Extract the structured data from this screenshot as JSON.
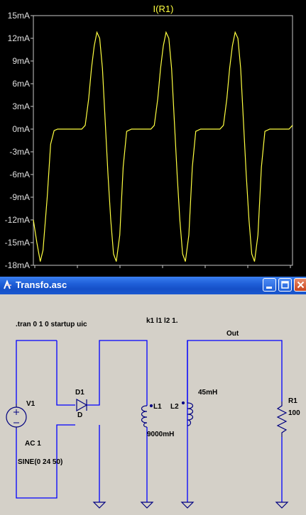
{
  "plot": {
    "title": "I(R1)",
    "y_ticks": [
      "15mA",
      "12mA",
      "9mA",
      "6mA",
      "3mA",
      "0mA",
      "-3mA",
      "-6mA",
      "-9mA",
      "-12mA",
      "-15mA",
      "-18mA"
    ],
    "trace_color": "#ffff40",
    "background": "#000000"
  },
  "chart_data": {
    "type": "line",
    "title": "I(R1)",
    "xlabel": "",
    "ylabel": "",
    "ylim": [
      -18,
      15
    ],
    "yunit": "mA",
    "grid": false,
    "series": [
      {
        "name": "I(R1)",
        "x": [
          0.0,
          0.05,
          0.1,
          0.14,
          0.2,
          0.25,
          0.3,
          0.35,
          0.42,
          0.5,
          0.58,
          0.65,
          0.7,
          0.75,
          0.8,
          0.84,
          0.88,
          0.92,
          0.96,
          1.0,
          1.04,
          1.08,
          1.12,
          1.16,
          1.2,
          1.25,
          1.3,
          1.35,
          1.42,
          1.5,
          1.58,
          1.65,
          1.7,
          1.75,
          1.8,
          1.84,
          1.88,
          1.92,
          1.96,
          2.0,
          2.04,
          2.08,
          2.12,
          2.16,
          2.2,
          2.25,
          2.3,
          2.35,
          2.42,
          2.5,
          2.58,
          2.65,
          2.7,
          2.75,
          2.8,
          2.84,
          2.88,
          2.92,
          2.96,
          3.0,
          3.04,
          3.08,
          3.12,
          3.16,
          3.2,
          3.25,
          3.3,
          3.35,
          3.42,
          3.5,
          3.58,
          3.65,
          3.7,
          3.75
        ],
        "y": [
          -12,
          -15,
          -17.5,
          -16,
          -9,
          -2,
          -0.2,
          0,
          0,
          0,
          0,
          0,
          0,
          0.5,
          4,
          8,
          11,
          12.8,
          12,
          8,
          1,
          -6,
          -12,
          -16.5,
          -17.5,
          -14,
          -5,
          -0.3,
          0,
          0,
          0,
          0,
          0,
          0.5,
          4,
          8,
          11,
          12.8,
          12,
          8,
          1,
          -6,
          -12,
          -16.5,
          -17.5,
          -14,
          -5,
          -0.3,
          0,
          0,
          0,
          0,
          0,
          0.5,
          4,
          8,
          11,
          12.8,
          12,
          8,
          1,
          -6,
          -12,
          -16.5,
          -17.5,
          -14,
          -5,
          -0.3,
          0,
          0,
          0,
          0,
          0,
          0.5
        ]
      }
    ]
  },
  "window": {
    "title": "Transfo.asc",
    "titlebar_color": "#2a66dc",
    "icons": [
      "ltspice-app-icon",
      "minimize-icon",
      "maximize-icon",
      "close-icon"
    ]
  },
  "schematic": {
    "directive_tran": ".tran 0 1 0 startup uic",
    "directive_k": "k1 l1 l2 1.",
    "net_out": "Out",
    "v1_name": "V1",
    "v1_ac": "AC 1",
    "v1_value": "SINE(0 24 50)",
    "d1_name": "D1",
    "d1_model": "D",
    "l1_name": "L1",
    "l1_value": "9000mH",
    "l2_name": "L2",
    "l2_value": "45mH",
    "r1_name": "R1",
    "r1_value": "100",
    "wire_color": "#0000ff",
    "component_color": "#000080",
    "background": "#d4d0c8"
  }
}
